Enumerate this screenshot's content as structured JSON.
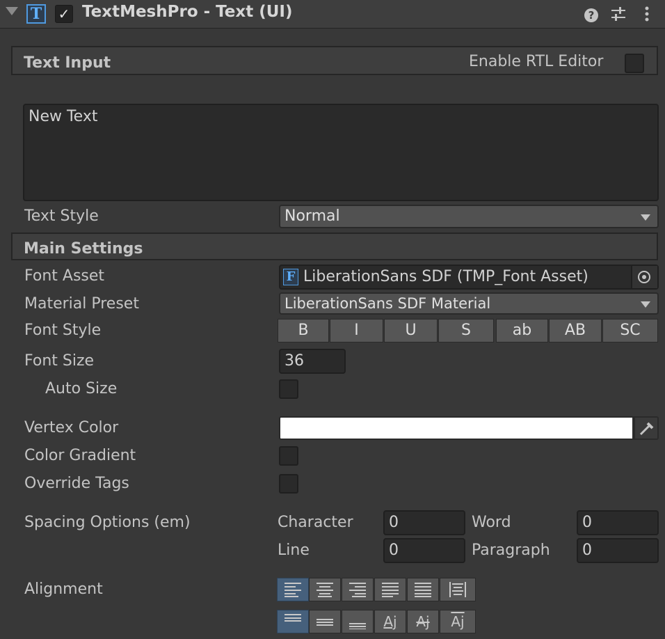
{
  "header": {
    "title": "TextMeshPro - Text (UI)",
    "component_icon": "T",
    "enabled_check": "✓",
    "icons": [
      "help-icon",
      "preset-sliders-icon",
      "kebab-menu-icon"
    ]
  },
  "text_input": {
    "section_title": "Text Input",
    "rtl_label": "Enable RTL Editor",
    "value": "New Text"
  },
  "text_style": {
    "label": "Text Style",
    "value": "Normal"
  },
  "main_settings": {
    "section_title": "Main Settings",
    "font_asset": {
      "label": "Font Asset",
      "icon_letter": "F",
      "value": "LiberationSans SDF (TMP_Font Asset)"
    },
    "material_preset": {
      "label": "Material Preset",
      "value": "LiberationSans SDF Material"
    },
    "font_style": {
      "label": "Font Style",
      "buttons": [
        "B",
        "I",
        "U",
        "S",
        "ab",
        "AB",
        "SC"
      ]
    },
    "font_size": {
      "label": "Font Size",
      "value": "36"
    },
    "auto_size": {
      "label": "Auto Size"
    },
    "vertex_color": {
      "label": "Vertex Color",
      "color": "#ffffff"
    },
    "color_gradient": {
      "label": "Color Gradient"
    },
    "override_tags": {
      "label": "Override Tags"
    },
    "spacing": {
      "label": "Spacing Options (em)",
      "character_label": "Character",
      "character_value": "0",
      "word_label": "Word",
      "word_value": "0",
      "line_label": "Line",
      "line_value": "0",
      "paragraph_label": "Paragraph",
      "paragraph_value": "0"
    },
    "alignment": {
      "label": "Alignment",
      "horizontal": [
        "align-left-icon",
        "align-center-icon",
        "align-right-icon",
        "align-justified-icon",
        "align-flush-icon",
        "align-geometry-center-icon"
      ],
      "vertical": [
        "align-top-icon",
        "align-middle-icon",
        "align-bottom-icon",
        "align-baseline-icon",
        "align-midline-icon",
        "align-capline-icon"
      ],
      "vertical_glyph": "Aj"
    }
  },
  "colors": {
    "accent": "#4f9ae0",
    "active_button": "#46607c",
    "background": "#383838"
  }
}
